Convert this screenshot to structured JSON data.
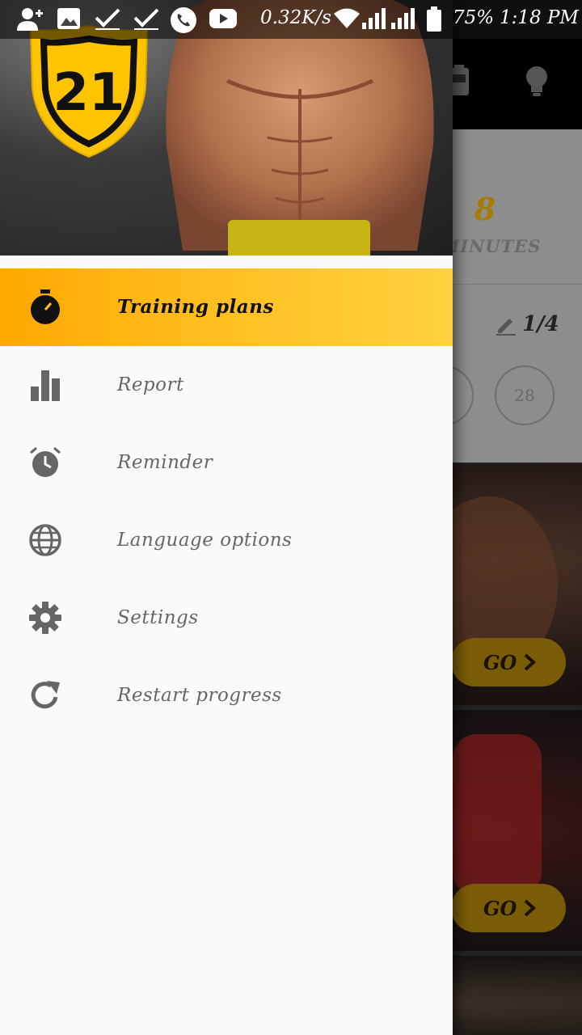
{
  "status_bar": {
    "net_speed": "0.32K/s",
    "battery": "75%",
    "time": "1:18 PM",
    "icons": [
      "add-contact-icon",
      "image-icon",
      "check-icon",
      "check-icon",
      "phone-icon",
      "youtube-icon",
      "wifi-icon",
      "signal-icon",
      "signal-icon",
      "battery-icon"
    ]
  },
  "drawer": {
    "logo_text": "21",
    "menu": [
      {
        "label": "Training plans",
        "icon": "stopwatch-icon",
        "active": true
      },
      {
        "label": "Report",
        "icon": "bar-chart-icon",
        "active": false
      },
      {
        "label": "Reminder",
        "icon": "alarm-clock-icon",
        "active": false
      },
      {
        "label": "Language options",
        "icon": "globe-icon",
        "active": false
      },
      {
        "label": "Settings",
        "icon": "gear-icon",
        "active": false
      },
      {
        "label": "Restart progress",
        "icon": "refresh-icon",
        "active": false
      }
    ]
  },
  "main": {
    "duration_value": "8",
    "duration_unit": "MINUTES",
    "progress_count": "1/4",
    "day_circle": "28",
    "go_label_1": "GO",
    "go_label_2": "GO"
  },
  "colors": {
    "accent": "#ffb000",
    "accent_light": "#ffd23f",
    "drawer_bg": "#fafafa",
    "menu_text": "#666666"
  }
}
